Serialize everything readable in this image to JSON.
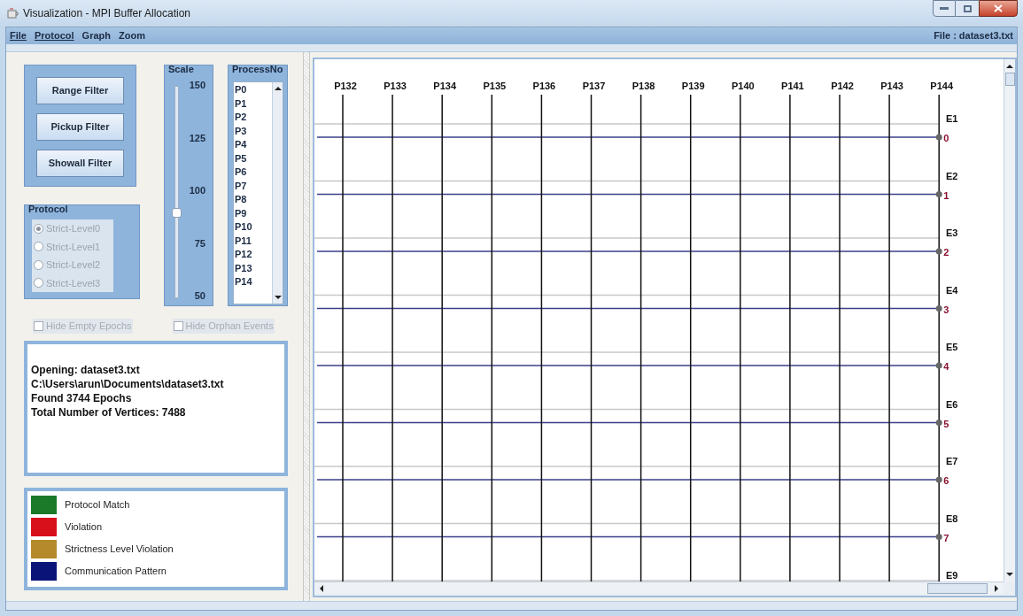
{
  "window": {
    "title": "Visualization -  MPI Buffer Allocation"
  },
  "menu": [
    {
      "label": "File",
      "mnemonic": true
    },
    {
      "label": "Protocol",
      "mnemonic": true
    },
    {
      "label": "Graph",
      "mnemonic": false
    },
    {
      "label": "Zoom",
      "mnemonic": false
    }
  ],
  "file_label": "File : dataset3.txt",
  "filter_buttons": [
    "Range Filter",
    "Pickup Filter",
    "Showall Filter"
  ],
  "scale": {
    "title": "Scale",
    "ticks": [
      "150",
      "125",
      "100",
      "75",
      "50"
    ],
    "level": 0.4
  },
  "process_list": {
    "title": "ProcessNo",
    "items": [
      "P0",
      "P1",
      "P2",
      "P3",
      "P4",
      "P5",
      "P6",
      "P7",
      "P8",
      "P9",
      "P10",
      "P11",
      "P12",
      "P13",
      "P14"
    ]
  },
  "protocol": {
    "title": "Protocol",
    "disabled": true,
    "options": [
      {
        "label": "Strict-Level0",
        "selected": true
      },
      {
        "label": "Strict-Level1",
        "selected": false
      },
      {
        "label": "Strict-Level2",
        "selected": false
      },
      {
        "label": "Strict-Level3",
        "selected": false
      }
    ]
  },
  "checkboxes": [
    {
      "label": "Hide Empty Epochs",
      "checked": false,
      "disabled": true
    },
    {
      "label": "Hide Orphan Events",
      "checked": false,
      "disabled": true
    }
  ],
  "log": [
    "Opening: dataset3.txt",
    "C:\\Users\\arun\\Documents\\dataset3.txt",
    "Found 3744 Epochs",
    "Total Number of Vertices: 7488"
  ],
  "legend": [
    {
      "label": "Protocol Match",
      "color": "#1a7a2a"
    },
    {
      "label": "Violation",
      "color": "#d8101c"
    },
    {
      "label": "Strictness Level Violation",
      "color": "#b58a2a"
    },
    {
      "label": "Communication Pattern",
      "color": "#0a1478"
    }
  ],
  "graph": {
    "processes": [
      "P132",
      "P133",
      "P134",
      "P135",
      "P136",
      "P137",
      "P138",
      "P139",
      "P140",
      "P141",
      "P142",
      "P143",
      "P144"
    ],
    "epochs": [
      {
        "label": "E1",
        "number": "0"
      },
      {
        "label": "E2",
        "number": "1"
      },
      {
        "label": "E3",
        "number": "2"
      },
      {
        "label": "E4",
        "number": "3"
      },
      {
        "label": "E5",
        "number": "4"
      },
      {
        "label": "E6",
        "number": "5"
      },
      {
        "label": "E7",
        "number": "6"
      },
      {
        "label": "E8",
        "number": "7"
      },
      {
        "label": "E9"
      }
    ]
  }
}
